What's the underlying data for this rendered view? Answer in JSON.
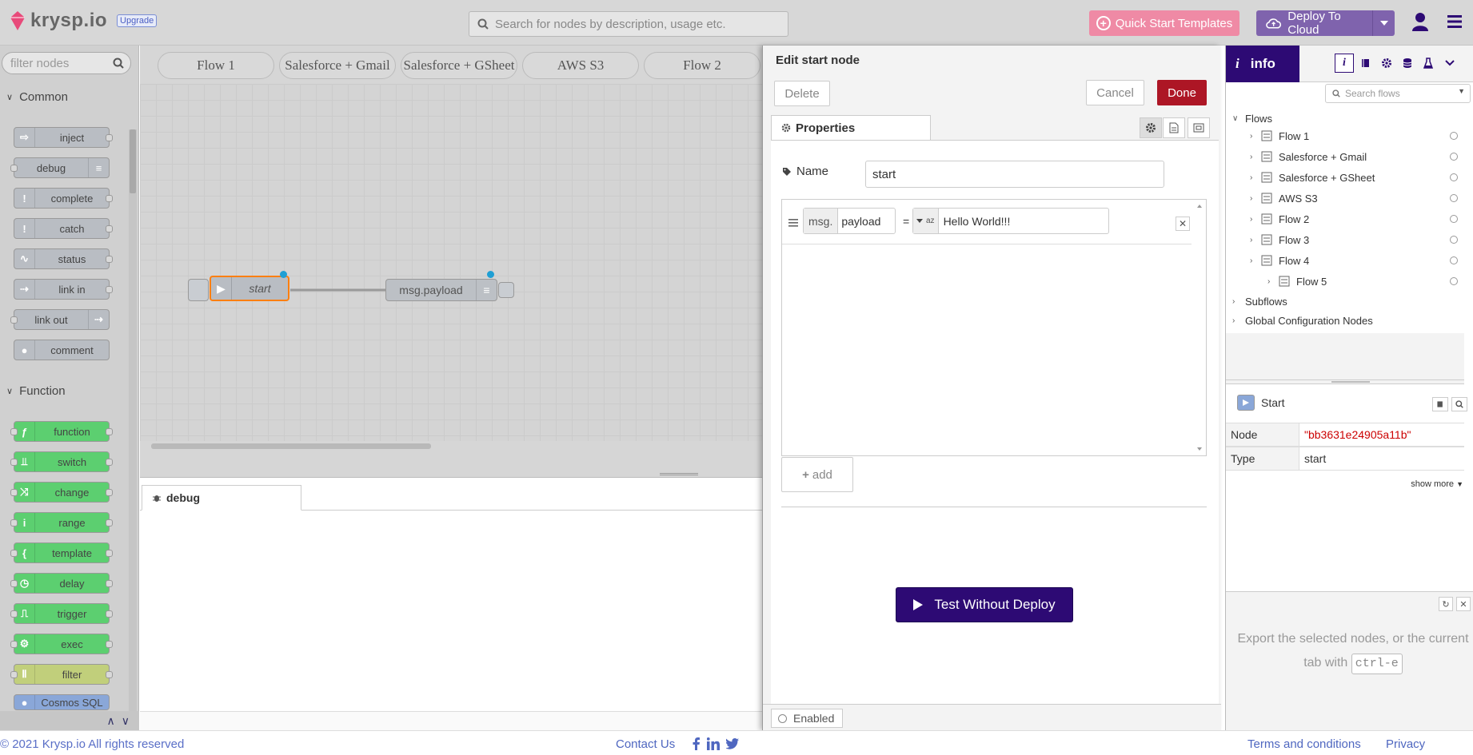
{
  "header": {
    "brand": "krysp.io",
    "upgrade_label": "Upgrade",
    "search_placeholder": "Search for nodes by description, usage etc.",
    "quick_start_label": "Quick Start Templates",
    "deploy_label": "Deploy To Cloud",
    "brand_color": "#e84a7a",
    "accent_color": "#2d0a74"
  },
  "palette": {
    "filter_placeholder": "filter nodes",
    "categories": [
      "Common",
      "Function"
    ],
    "common_nodes": [
      "inject",
      "debug",
      "complete",
      "catch",
      "status",
      "link in",
      "link out",
      "comment"
    ],
    "function_nodes": [
      "function",
      "switch",
      "change",
      "range",
      "template",
      "delay",
      "trigger",
      "exec",
      "filter",
      "Cosmos SQL"
    ]
  },
  "workspace": {
    "tabs": [
      "Flow 1",
      "Salesforce + Gmail",
      "Salesforce + GSheet",
      "AWS S3",
      "Flow 2"
    ],
    "nodes": {
      "start_label": "start",
      "debug_label": "msg.payload"
    }
  },
  "debug_panel": {
    "tab_label": "debug"
  },
  "tray": {
    "title": "Edit start node",
    "delete_label": "Delete",
    "cancel_label": "Cancel",
    "done_label": "Done",
    "properties_tab": "Properties",
    "name_label": "Name",
    "name_value": "start",
    "rule": {
      "target_prefix": "msg.",
      "target_value": "payload",
      "operator": "=",
      "value_type_icon": "az",
      "value": "Hello World!!!"
    },
    "add_label": "add",
    "test_label": "Test Without Deploy",
    "enabled_label": "Enabled"
  },
  "sidebar": {
    "active_tab": "info",
    "search_placeholder": "Search flows",
    "tree": {
      "root": "Flows",
      "flows": [
        "Flow 1",
        "Salesforce + Gmail",
        "Salesforce + GSheet",
        "AWS S3",
        "Flow 2",
        "Flow 3",
        "Flow 4"
      ],
      "nested_flow": "Flow 5",
      "subflows": "Subflows",
      "global_config": "Global Configuration Nodes"
    },
    "info": {
      "node_title": "Start",
      "rows": [
        {
          "key": "Node",
          "value": "\"bb3631e24905a11b\""
        },
        {
          "key": "Type",
          "value": "start"
        }
      ],
      "show_more": "show more"
    },
    "help": {
      "text": "Export the selected nodes, or the current tab with",
      "shortcut": "ctrl-e"
    }
  },
  "footer": {
    "copyright": "© 2021 Krysp.io All rights reserved",
    "contact": "Contact Us",
    "terms": "Terms and conditions",
    "privacy": "Privacy"
  }
}
